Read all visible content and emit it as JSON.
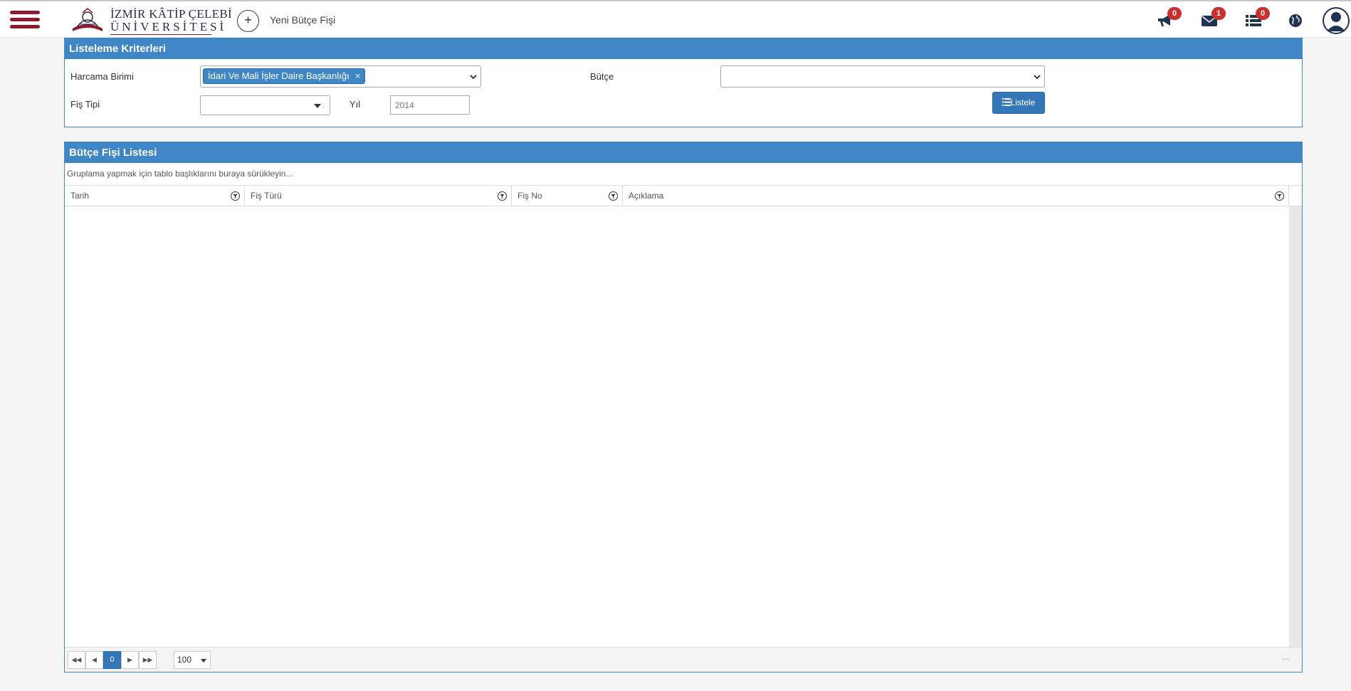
{
  "header": {
    "logo_line1": "İZMİR KÂTİP ÇELEBİ",
    "logo_line2": "ÜNİVERSİTESİ",
    "new_button_symbol": "+",
    "new_label": "Yeni Bütçe Fişi",
    "icons": [
      {
        "name": "announcements-icon",
        "badge": "0"
      },
      {
        "name": "messages-icon",
        "badge": "1"
      },
      {
        "name": "tasks-icon",
        "badge": "0"
      }
    ],
    "brand_color": "#8e1b2b"
  },
  "criteria": {
    "title": "Listeleme Kriterleri",
    "harcama_label": "Harcama Birimi",
    "harcama_value": "İdari Ve Mali İşler Daire Başkanlığı",
    "harcama_remove": "×",
    "butce_label": "Bütçe",
    "butce_value": "",
    "fis_tipi_label": "Fiş Tipi",
    "fis_tipi_value": "",
    "yil_label": "Yıl",
    "yil_placeholder": "2014",
    "listele_label": "Listele"
  },
  "list": {
    "title": "Bütçe Fişi Listesi",
    "group_hint": "Gruplama yapmak için tablo başlıklarını buraya sürükleyin...",
    "columns": [
      "Tarih",
      "Fiş Türü",
      "Fiş No",
      "Açıklama"
    ],
    "rows": [],
    "pager": {
      "current_page": "0",
      "page_size": "100",
      "info": "..."
    }
  },
  "colors": {
    "accent": "#3f86c6",
    "badge": "#c9302c"
  }
}
